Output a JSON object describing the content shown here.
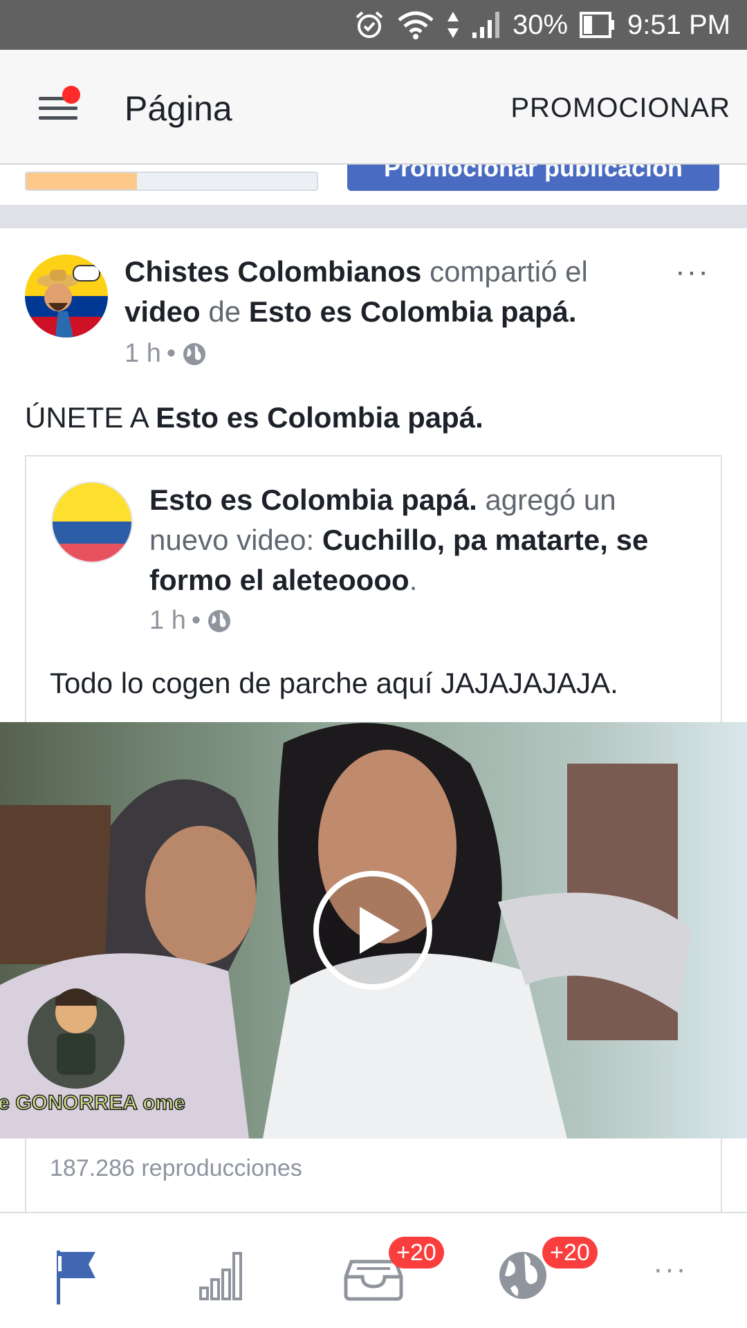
{
  "status_bar": {
    "battery": "30%",
    "time": "9:51 PM"
  },
  "header": {
    "title": "Página",
    "promote_label": "PROMOCIONAR"
  },
  "partial_top": {
    "progress_fraction": 0.38,
    "promote_post_label": "Promocionar publicación"
  },
  "post": {
    "author": "Chistes Colombianos",
    "action": " compartió el ",
    "object": "video",
    "connector": " de ",
    "source": "Esto es Colombia papá.",
    "time": "1 h",
    "meta_sep": "•",
    "more": "···",
    "text_prefix": "ÚNETE A ",
    "text_bold": "Esto es Colombia papá."
  },
  "shared": {
    "author": "Esto es Colombia papá.",
    "action": " agregó un nuevo video: ",
    "title": "Cuchillo, pa matarte, se formo el aleteoooo",
    "title_end": ".",
    "time": "1 h",
    "meta_sep": "•",
    "text": "Todo lo cogen de parche aquí JAJAJAJAJA.",
    "watermark": "ome GONORREA ome",
    "views": "187.286 reproducciones"
  },
  "bottom_nav": {
    "inbox_badge": "+20",
    "notifications_badge": "+20",
    "more": "···"
  },
  "colors": {
    "status_bar": "#616161",
    "accent": "#4267b2",
    "badge": "#fa3e3e",
    "progress": "#fcc98a"
  }
}
